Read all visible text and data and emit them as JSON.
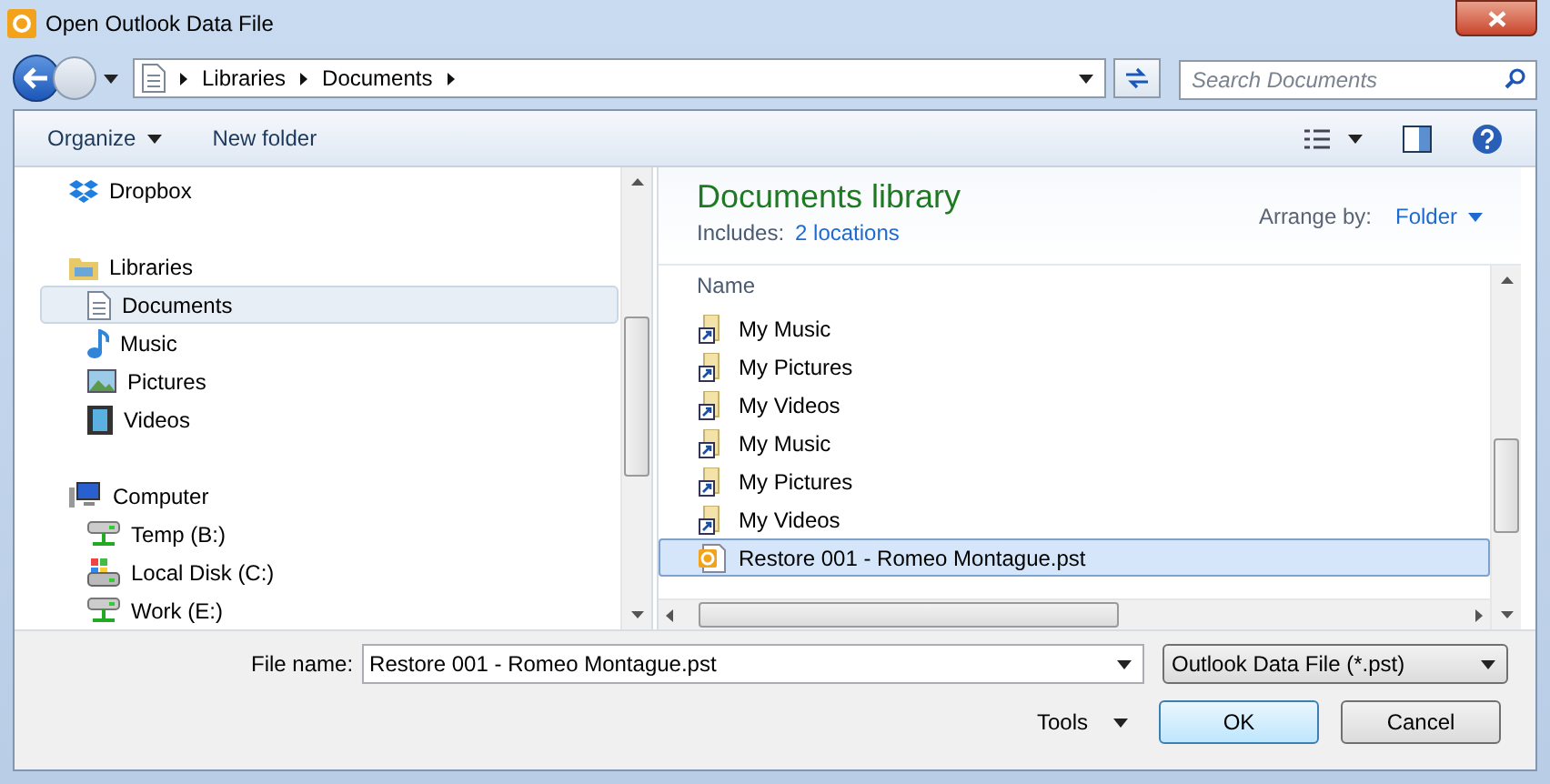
{
  "window": {
    "title": "Open Outlook Data File"
  },
  "address_bar": {
    "path": [
      "Libraries",
      "Documents"
    ]
  },
  "search": {
    "placeholder": "Search Documents"
  },
  "toolbar": {
    "organize": "Organize",
    "new_folder": "New folder"
  },
  "nav": [
    {
      "label": "Dropbox",
      "kind": "dropbox",
      "selected": false
    },
    {
      "label": "Libraries",
      "kind": "library",
      "selected": false,
      "children": [
        {
          "label": "Documents",
          "kind": "document",
          "selected": true
        },
        {
          "label": "Music",
          "kind": "music",
          "selected": false
        },
        {
          "label": "Pictures",
          "kind": "picture",
          "selected": false
        },
        {
          "label": "Videos",
          "kind": "video",
          "selected": false
        }
      ]
    },
    {
      "label": "Computer",
      "kind": "computer",
      "selected": false,
      "children": [
        {
          "label": "Temp (B:)",
          "kind": "network-drive",
          "selected": false
        },
        {
          "label": "Local Disk (C:)",
          "kind": "local-disk",
          "selected": false
        },
        {
          "label": "Work (E:)",
          "kind": "network-drive",
          "selected": false
        }
      ]
    }
  ],
  "library": {
    "title": "Documents library",
    "includes_label": "Includes:",
    "includes_link": "2 locations",
    "arrange_label": "Arrange by:",
    "arrange_value": "Folder"
  },
  "file_list": {
    "column": "Name",
    "rows": [
      {
        "name": "My Music",
        "kind": "shortcut",
        "selected": false
      },
      {
        "name": "My Pictures",
        "kind": "shortcut",
        "selected": false
      },
      {
        "name": "My Videos",
        "kind": "shortcut",
        "selected": false
      },
      {
        "name": "My Music",
        "kind": "shortcut",
        "selected": false
      },
      {
        "name": "My Pictures",
        "kind": "shortcut",
        "selected": false
      },
      {
        "name": "My Videos",
        "kind": "shortcut",
        "selected": false
      },
      {
        "name": "Restore 001 - Romeo Montague.pst",
        "kind": "pst",
        "selected": true
      }
    ]
  },
  "footer": {
    "file_name_label": "File name:",
    "file_name": "Restore 001 - Romeo Montague.pst",
    "file_type": "Outlook Data File (*.pst)",
    "tools": "Tools",
    "ok": "OK",
    "cancel": "Cancel"
  }
}
